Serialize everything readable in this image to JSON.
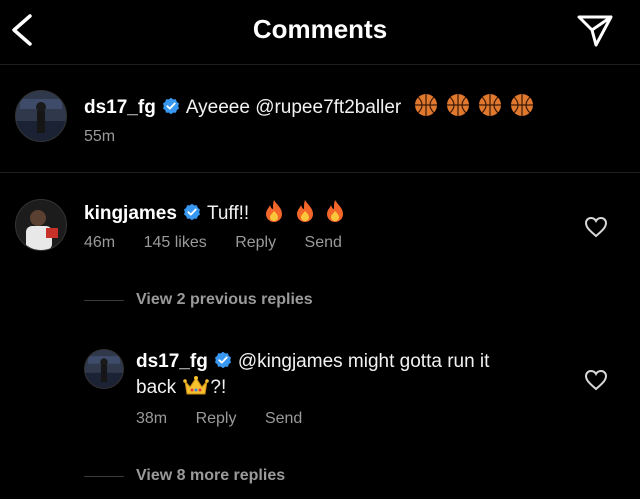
{
  "header": {
    "title": "Comments",
    "back_icon": "chevron-left-icon",
    "send_icon": "paper-plane-icon"
  },
  "caption": {
    "username": "ds17_fg",
    "text": "Ayeeee @rupee7ft2baller",
    "emoji": [
      "basketball",
      "basketball",
      "basketball",
      "basketball"
    ],
    "time": "55m"
  },
  "comments": [
    {
      "username": "kingjames",
      "text": "Tuff!!",
      "emoji": [
        "fire",
        "fire",
        "fire"
      ],
      "time": "46m",
      "likes": "145 likes",
      "reply_label": "Reply",
      "send_label": "Send"
    }
  ],
  "view_previous": "View 2 previous replies",
  "reply": {
    "username": "ds17_fg",
    "text_line1": "@kingjames might gotta run it",
    "text_line2_prefix": "back",
    "text_line2_suffix": "?!",
    "time": "38m",
    "reply_label": "Reply",
    "send_label": "Send"
  },
  "view_more": "View 8 more replies",
  "colors": {
    "verified": "#3897f0",
    "meta": "#9a9a9a",
    "background": "#000000"
  }
}
